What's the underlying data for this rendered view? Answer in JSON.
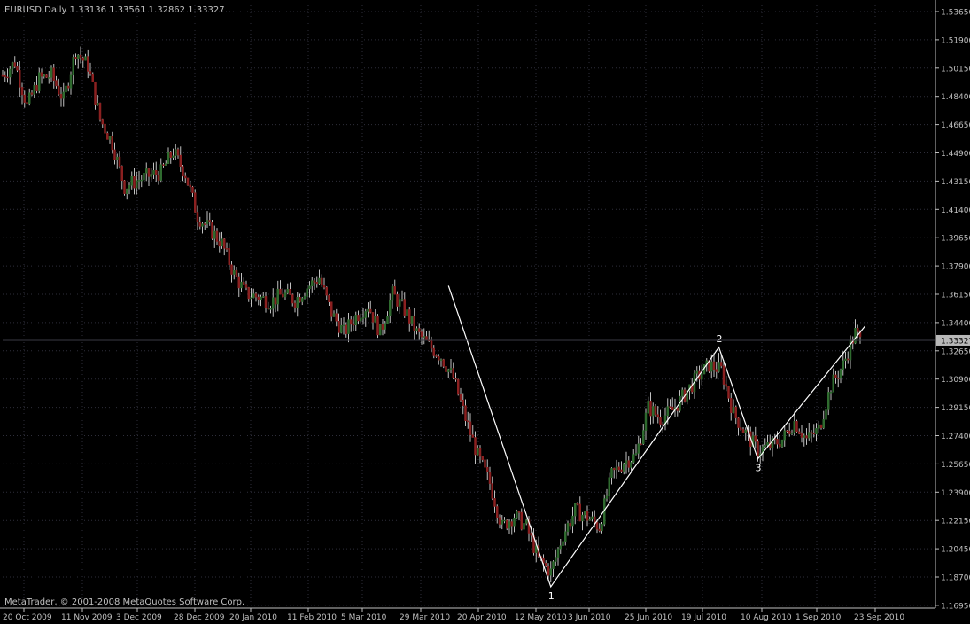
{
  "window": {
    "header": "EURUSD,Daily  1.33136 1.33561 1.32862 1.33327",
    "copyright": "MetaTrader, © 2001-2008 MetaQuotes Software Corp."
  },
  "colors": {
    "background": "#000000",
    "axis": "#c0c0c0",
    "grid": "#2e2e3a",
    "bull_candle": "#2f6b2f",
    "bear_candle": "#8b2020",
    "wick": "#c0c0c0",
    "pattern_line": "#ffffff",
    "last_price_bg": "#b8b8b8",
    "last_price_text": "#000000"
  },
  "chart_data": {
    "type": "candlestick",
    "title": "",
    "xlabel": "",
    "ylabel": "",
    "symbol": "EURUSD",
    "timeframe": "Daily",
    "last_price": "1.33327",
    "ylim": [
      1.1695,
      1.5365
    ],
    "y_ticks": [
      "1.53650",
      "1.51900",
      "1.50150",
      "1.48400",
      "1.46650",
      "1.44900",
      "1.43150",
      "1.41400",
      "1.39650",
      "1.37900",
      "1.36150",
      "1.34400",
      "1.32650",
      "1.30900",
      "1.29150",
      "1.27400",
      "1.25650",
      "1.23900",
      "1.22150",
      "1.20450",
      "1.18700",
      "1.16950"
    ],
    "x_ticks": [
      "20 Oct 2009",
      "11 Nov 2009",
      "3 Dec 2009",
      "28 Dec 2009",
      "20 Jan 2010",
      "11 Feb 2010",
      "5 Mar 2010",
      "29 Mar 2010",
      "20 Apr 2010",
      "12 May 2010",
      "3 Jun 2010",
      "25 Jun 2010",
      "19 Jul 2010",
      "10 Aug 2010",
      "1 Sep 2010",
      "23 Sep 2010"
    ],
    "anchors": [
      {
        "d": 0,
        "p": 1.497
      },
      {
        "d": 5,
        "p": 1.505
      },
      {
        "d": 10,
        "p": 1.478
      },
      {
        "d": 15,
        "p": 1.495
      },
      {
        "d": 20,
        "p": 1.497
      },
      {
        "d": 25,
        "p": 1.482
      },
      {
        "d": 30,
        "p": 1.512
      },
      {
        "d": 35,
        "p": 1.503
      },
      {
        "d": 40,
        "p": 1.47
      },
      {
        "d": 45,
        "p": 1.455
      },
      {
        "d": 50,
        "p": 1.428
      },
      {
        "d": 55,
        "p": 1.432
      },
      {
        "d": 60,
        "p": 1.435
      },
      {
        "d": 65,
        "p": 1.437
      },
      {
        "d": 70,
        "p": 1.45
      },
      {
        "d": 75,
        "p": 1.436
      },
      {
        "d": 80,
        "p": 1.41
      },
      {
        "d": 85,
        "p": 1.402
      },
      {
        "d": 90,
        "p": 1.393
      },
      {
        "d": 95,
        "p": 1.374
      },
      {
        "d": 100,
        "p": 1.362
      },
      {
        "d": 105,
        "p": 1.36
      },
      {
        "d": 110,
        "p": 1.357
      },
      {
        "d": 115,
        "p": 1.362
      },
      {
        "d": 120,
        "p": 1.358
      },
      {
        "d": 125,
        "p": 1.366
      },
      {
        "d": 130,
        "p": 1.372
      },
      {
        "d": 135,
        "p": 1.35
      },
      {
        "d": 140,
        "p": 1.338
      },
      {
        "d": 145,
        "p": 1.348
      },
      {
        "d": 150,
        "p": 1.355
      },
      {
        "d": 155,
        "p": 1.338
      },
      {
        "d": 160,
        "p": 1.362
      },
      {
        "d": 165,
        "p": 1.352
      },
      {
        "d": 170,
        "p": 1.338
      },
      {
        "d": 175,
        "p": 1.33
      },
      {
        "d": 180,
        "p": 1.323
      },
      {
        "d": 185,
        "p": 1.31
      },
      {
        "d": 190,
        "p": 1.285
      },
      {
        "d": 195,
        "p": 1.262
      },
      {
        "d": 200,
        "p": 1.245
      },
      {
        "d": 205,
        "p": 1.218
      },
      {
        "d": 210,
        "p": 1.225
      },
      {
        "d": 215,
        "p": 1.218
      },
      {
        "d": 220,
        "p": 1.198
      },
      {
        "d": 225,
        "p": 1.19
      },
      {
        "d": 230,
        "p": 1.213
      },
      {
        "d": 235,
        "p": 1.228
      },
      {
        "d": 240,
        "p": 1.224
      },
      {
        "d": 245,
        "p": 1.218
      },
      {
        "d": 250,
        "p": 1.25
      },
      {
        "d": 255,
        "p": 1.258
      },
      {
        "d": 260,
        "p": 1.262
      },
      {
        "d": 265,
        "p": 1.292
      },
      {
        "d": 270,
        "p": 1.285
      },
      {
        "d": 275,
        "p": 1.29
      },
      {
        "d": 280,
        "p": 1.3
      },
      {
        "d": 285,
        "p": 1.31
      },
      {
        "d": 290,
        "p": 1.318
      },
      {
        "d": 295,
        "p": 1.315
      },
      {
        "d": 300,
        "p": 1.288
      },
      {
        "d": 305,
        "p": 1.276
      },
      {
        "d": 310,
        "p": 1.265
      },
      {
        "d": 315,
        "p": 1.268
      },
      {
        "d": 320,
        "p": 1.272
      },
      {
        "d": 325,
        "p": 1.283
      },
      {
        "d": 330,
        "p": 1.272
      },
      {
        "d": 335,
        "p": 1.278
      },
      {
        "d": 340,
        "p": 1.305
      },
      {
        "d": 345,
        "p": 1.318
      },
      {
        "d": 350,
        "p": 1.338
      },
      {
        "d": 352,
        "p": 1.333
      }
    ],
    "pattern": {
      "line": [
        {
          "d": 183,
          "p": 1.367,
          "label": ""
        },
        {
          "d": 225,
          "p": 1.181,
          "label": "1"
        },
        {
          "d": 294,
          "p": 1.329,
          "label": "2"
        },
        {
          "d": 310,
          "p": 1.26,
          "label": "3"
        },
        {
          "d": 354,
          "p": 1.342,
          "label": ""
        }
      ]
    }
  }
}
